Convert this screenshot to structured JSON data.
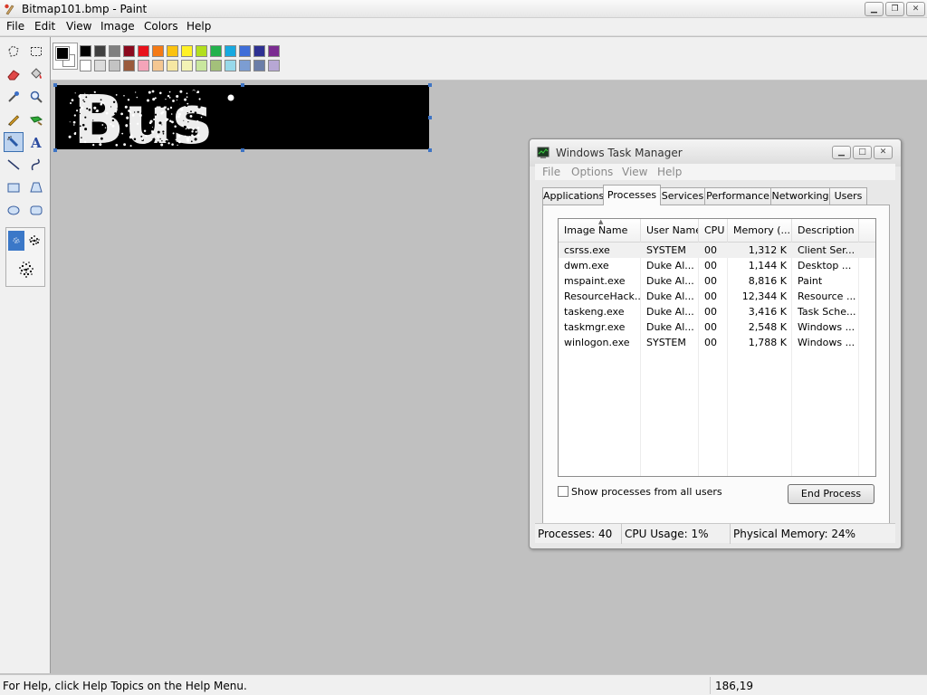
{
  "paint": {
    "title": "Bitmap101.bmp - Paint",
    "menu": [
      "File",
      "Edit",
      "View",
      "Image",
      "Colors",
      "Help"
    ],
    "status_help": "For Help, click Help Topics on the Help Menu.",
    "status_coords": "186,19",
    "colors": {
      "foreground": "#000000",
      "background": "#ffffff",
      "palette_row1": [
        "#000000",
        "#404040",
        "#808080",
        "#8b0a1e",
        "#e8121b",
        "#f47a16",
        "#fbc20f",
        "#fff126",
        "#b2df1e",
        "#22b14c",
        "#17a9e0",
        "#3f6ed8",
        "#2e3192",
        "#7b2c91"
      ],
      "palette_row2": [
        "#ffffff",
        "#dcdcdc",
        "#c3c3c3",
        "#9a5a3c",
        "#f4a4b9",
        "#f5c792",
        "#f6e7a3",
        "#f3f3b5",
        "#c9e79e",
        "#a3c07a",
        "#98d9ea",
        "#7c9dd2",
        "#6c7ea8",
        "#b7a7d4"
      ]
    },
    "canvas_text": "Bus"
  },
  "task_manager": {
    "title": "Windows Task Manager",
    "menu": [
      "File",
      "Options",
      "View",
      "Help"
    ],
    "tabs": [
      "Applications",
      "Processes",
      "Services",
      "Performance",
      "Networking",
      "Users"
    ],
    "active_tab": "Processes",
    "columns": [
      "Image Name",
      "User Name",
      "CPU",
      "Memory (...",
      "Description"
    ],
    "rows": [
      {
        "image": "csrss.exe",
        "user": "SYSTEM",
        "cpu": "00",
        "memory": "1,312 K",
        "desc": "Client Ser..."
      },
      {
        "image": "dwm.exe",
        "user": "Duke Al...",
        "cpu": "00",
        "memory": "1,144 K",
        "desc": "Desktop ..."
      },
      {
        "image": "mspaint.exe",
        "user": "Duke Al...",
        "cpu": "00",
        "memory": "8,816 K",
        "desc": "Paint"
      },
      {
        "image": "ResourceHack...",
        "user": "Duke Al...",
        "cpu": "00",
        "memory": "12,344 K",
        "desc": "Resource ..."
      },
      {
        "image": "taskeng.exe",
        "user": "Duke Al...",
        "cpu": "00",
        "memory": "3,416 K",
        "desc": "Task Sche..."
      },
      {
        "image": "taskmgr.exe",
        "user": "Duke Al...",
        "cpu": "00",
        "memory": "2,548 K",
        "desc": "Windows ..."
      },
      {
        "image": "winlogon.exe",
        "user": "SYSTEM",
        "cpu": "00",
        "memory": "1,788 K",
        "desc": "Windows ..."
      }
    ],
    "show_all_label": "Show processes from all users",
    "end_process_label": "End Process",
    "status": {
      "processes": "Processes: 40",
      "cpu": "CPU Usage: 1%",
      "memory": "Physical Memory: 24%"
    }
  }
}
